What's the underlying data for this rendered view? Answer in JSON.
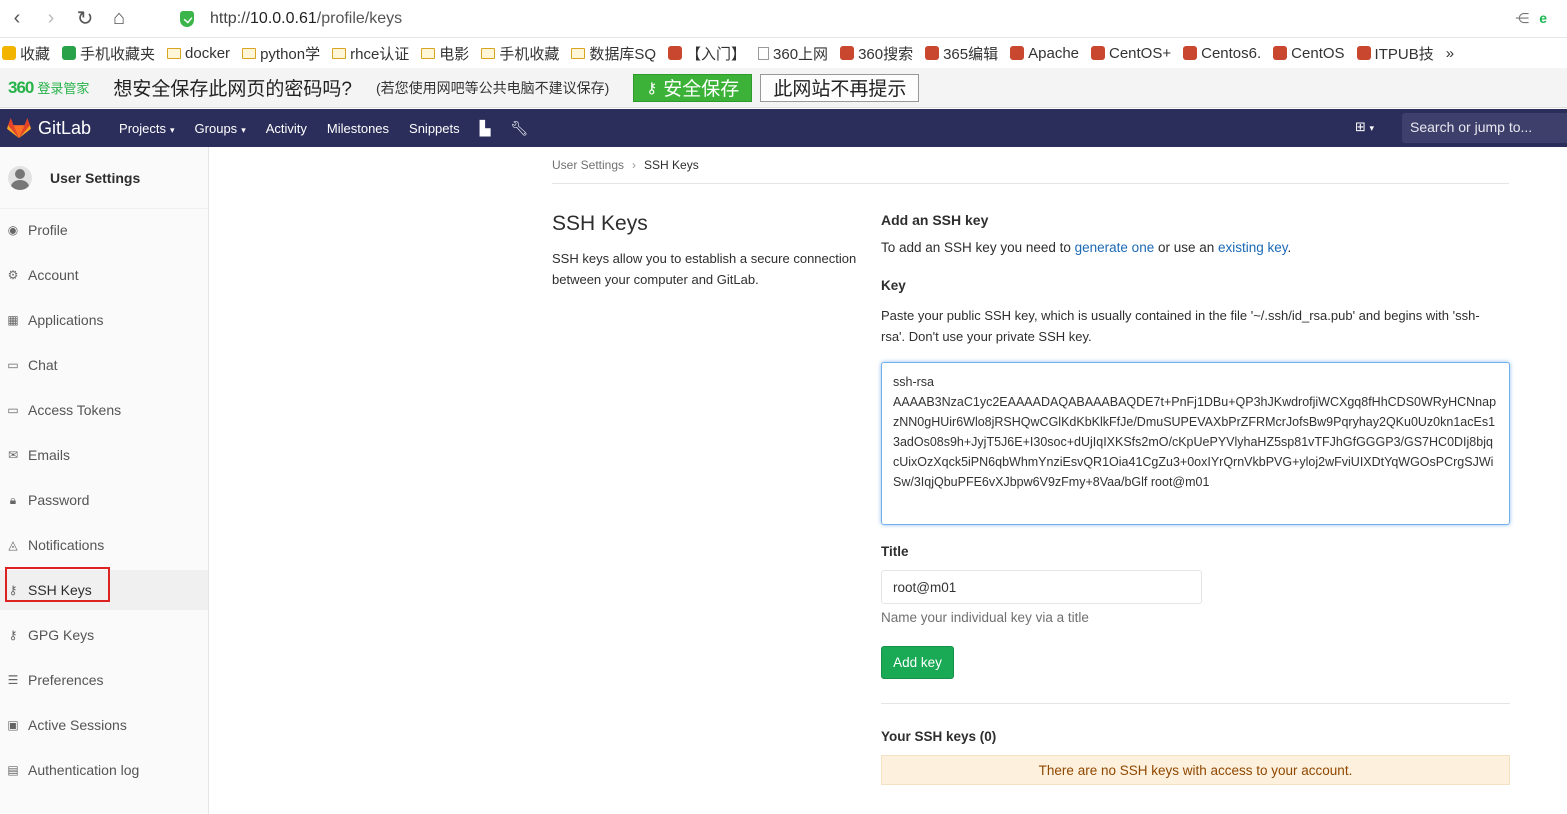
{
  "browser": {
    "url_prefix": "http://",
    "url_host": "10.0.0.61",
    "url_path": "/profile/keys",
    "right_icons": [
      "share-icon",
      "browser-e-icon"
    ]
  },
  "bookmarks": [
    {
      "label": "收藏",
      "kind": "star"
    },
    {
      "label": "手机收藏夹",
      "kind": "phone"
    },
    {
      "label": "docker",
      "kind": "folder"
    },
    {
      "label": "python学",
      "kind": "folder"
    },
    {
      "label": "rhce认证",
      "kind": "folder"
    },
    {
      "label": "电影",
      "kind": "folder"
    },
    {
      "label": "手机收藏",
      "kind": "folder"
    },
    {
      "label": "数据库SQ",
      "kind": "folder"
    },
    {
      "label": "【入门】",
      "kind": "site"
    },
    {
      "label": "360上网",
      "kind": "page"
    },
    {
      "label": "360搜索",
      "kind": "site"
    },
    {
      "label": "365编辑",
      "kind": "site"
    },
    {
      "label": "Apache",
      "kind": "site"
    },
    {
      "label": "CentOS+",
      "kind": "site"
    },
    {
      "label": "Centos6.",
      "kind": "site"
    },
    {
      "label": "CentOS",
      "kind": "site"
    },
    {
      "label": "ITPUB技",
      "kind": "site"
    },
    {
      "label": "»",
      "kind": "more"
    }
  ],
  "password_bar": {
    "brand": "360",
    "brand_sub": "登录管家",
    "question": "想安全保存此网页的密码吗?",
    "note": "(若您使用网吧等公共电脑不建议保存)",
    "save_label": "安全保存",
    "never_label": "此网站不再提示"
  },
  "header": {
    "brand": "GitLab",
    "nav": [
      {
        "label": "Projects",
        "dropdown": true
      },
      {
        "label": "Groups",
        "dropdown": true
      },
      {
        "label": "Activity",
        "dropdown": false
      },
      {
        "label": "Milestones",
        "dropdown": false
      },
      {
        "label": "Snippets",
        "dropdown": false
      }
    ],
    "search_placeholder": "Search or jump to..."
  },
  "sidebar": {
    "title": "User Settings",
    "items": [
      {
        "label": "Profile",
        "icon": "user-circle-icon"
      },
      {
        "label": "Account",
        "icon": "account-gears-icon"
      },
      {
        "label": "Applications",
        "icon": "grid-icon"
      },
      {
        "label": "Chat",
        "icon": "chat-icon"
      },
      {
        "label": "Access Tokens",
        "icon": "token-icon"
      },
      {
        "label": "Emails",
        "icon": "envelope-icon"
      },
      {
        "label": "Password",
        "icon": "lock-icon"
      },
      {
        "label": "Notifications",
        "icon": "bell-icon"
      },
      {
        "label": "SSH Keys",
        "icon": "key-icon",
        "active": true
      },
      {
        "label": "GPG Keys",
        "icon": "key-icon"
      },
      {
        "label": "Preferences",
        "icon": "sliders-icon"
      },
      {
        "label": "Active Sessions",
        "icon": "monitor-icon"
      },
      {
        "label": "Authentication log",
        "icon": "log-icon"
      }
    ]
  },
  "breadcrumb": {
    "parent": "User Settings",
    "current": "SSH Keys"
  },
  "intro": {
    "title": "SSH Keys",
    "description": "SSH keys allow you to establish a secure connection between your computer and GitLab."
  },
  "form": {
    "heading": "Add an SSH key",
    "desc_before": "To add an SSH key you need to ",
    "desc_link1": "generate one",
    "desc_middle": " or use an ",
    "desc_link2": "existing key",
    "desc_after": ".",
    "key_label": "Key",
    "key_help": "Paste your public SSH key, which is usually contained in the file '~/.ssh/id_rsa.pub' and begins with 'ssh-rsa'. Don't use your private SSH key.",
    "key_value": "ssh-rsa\nAAAAB3NzaC1yc2EAAAADAQABAAABAQDE7t+PnFj1DBu+QP3hJKwdrofjiWCXgq8fHhCDS0WRyHCNnapzNN0gHUir6Wlo8jRSHQwCGlKdKbKlkFfJe/DmuSUPEVAXbPrZFRMcrJofsBw9Pqryhay2QKu0Uz0kn1acEs13adOs08s9h+JyjT5J6E+I30soc+dUjIqIXKSfs2mO/cKpUePYVlyhaHZ5sp81vTFJhGfGGGP3/GS7HC0DIj8bjqcUixOzXqck5iPN6qbWhmYnziEsvQR1Oia41CgZu3+0oxIYrQrnVkbPVG+yloj2wFviUIXDtYqWGOsPCrgSJWiSw/3IqjQbuPFE6vXJbpw6V9zFmy+8Vaa/bGlf root@m01",
    "title_label": "Title",
    "title_value": "root@m01",
    "title_help": "Name your individual key via a title",
    "submit_label": "Add key"
  },
  "existing": {
    "heading": "Your SSH keys (0)",
    "empty_message": "There are no SSH keys with access to your account."
  },
  "colors": {
    "header_bg": "#2b2d5b",
    "primary_green": "#1aaa55",
    "link": "#1b69b6",
    "warning_bg": "#fdf1dd",
    "highlight_red": "#dd2222"
  }
}
